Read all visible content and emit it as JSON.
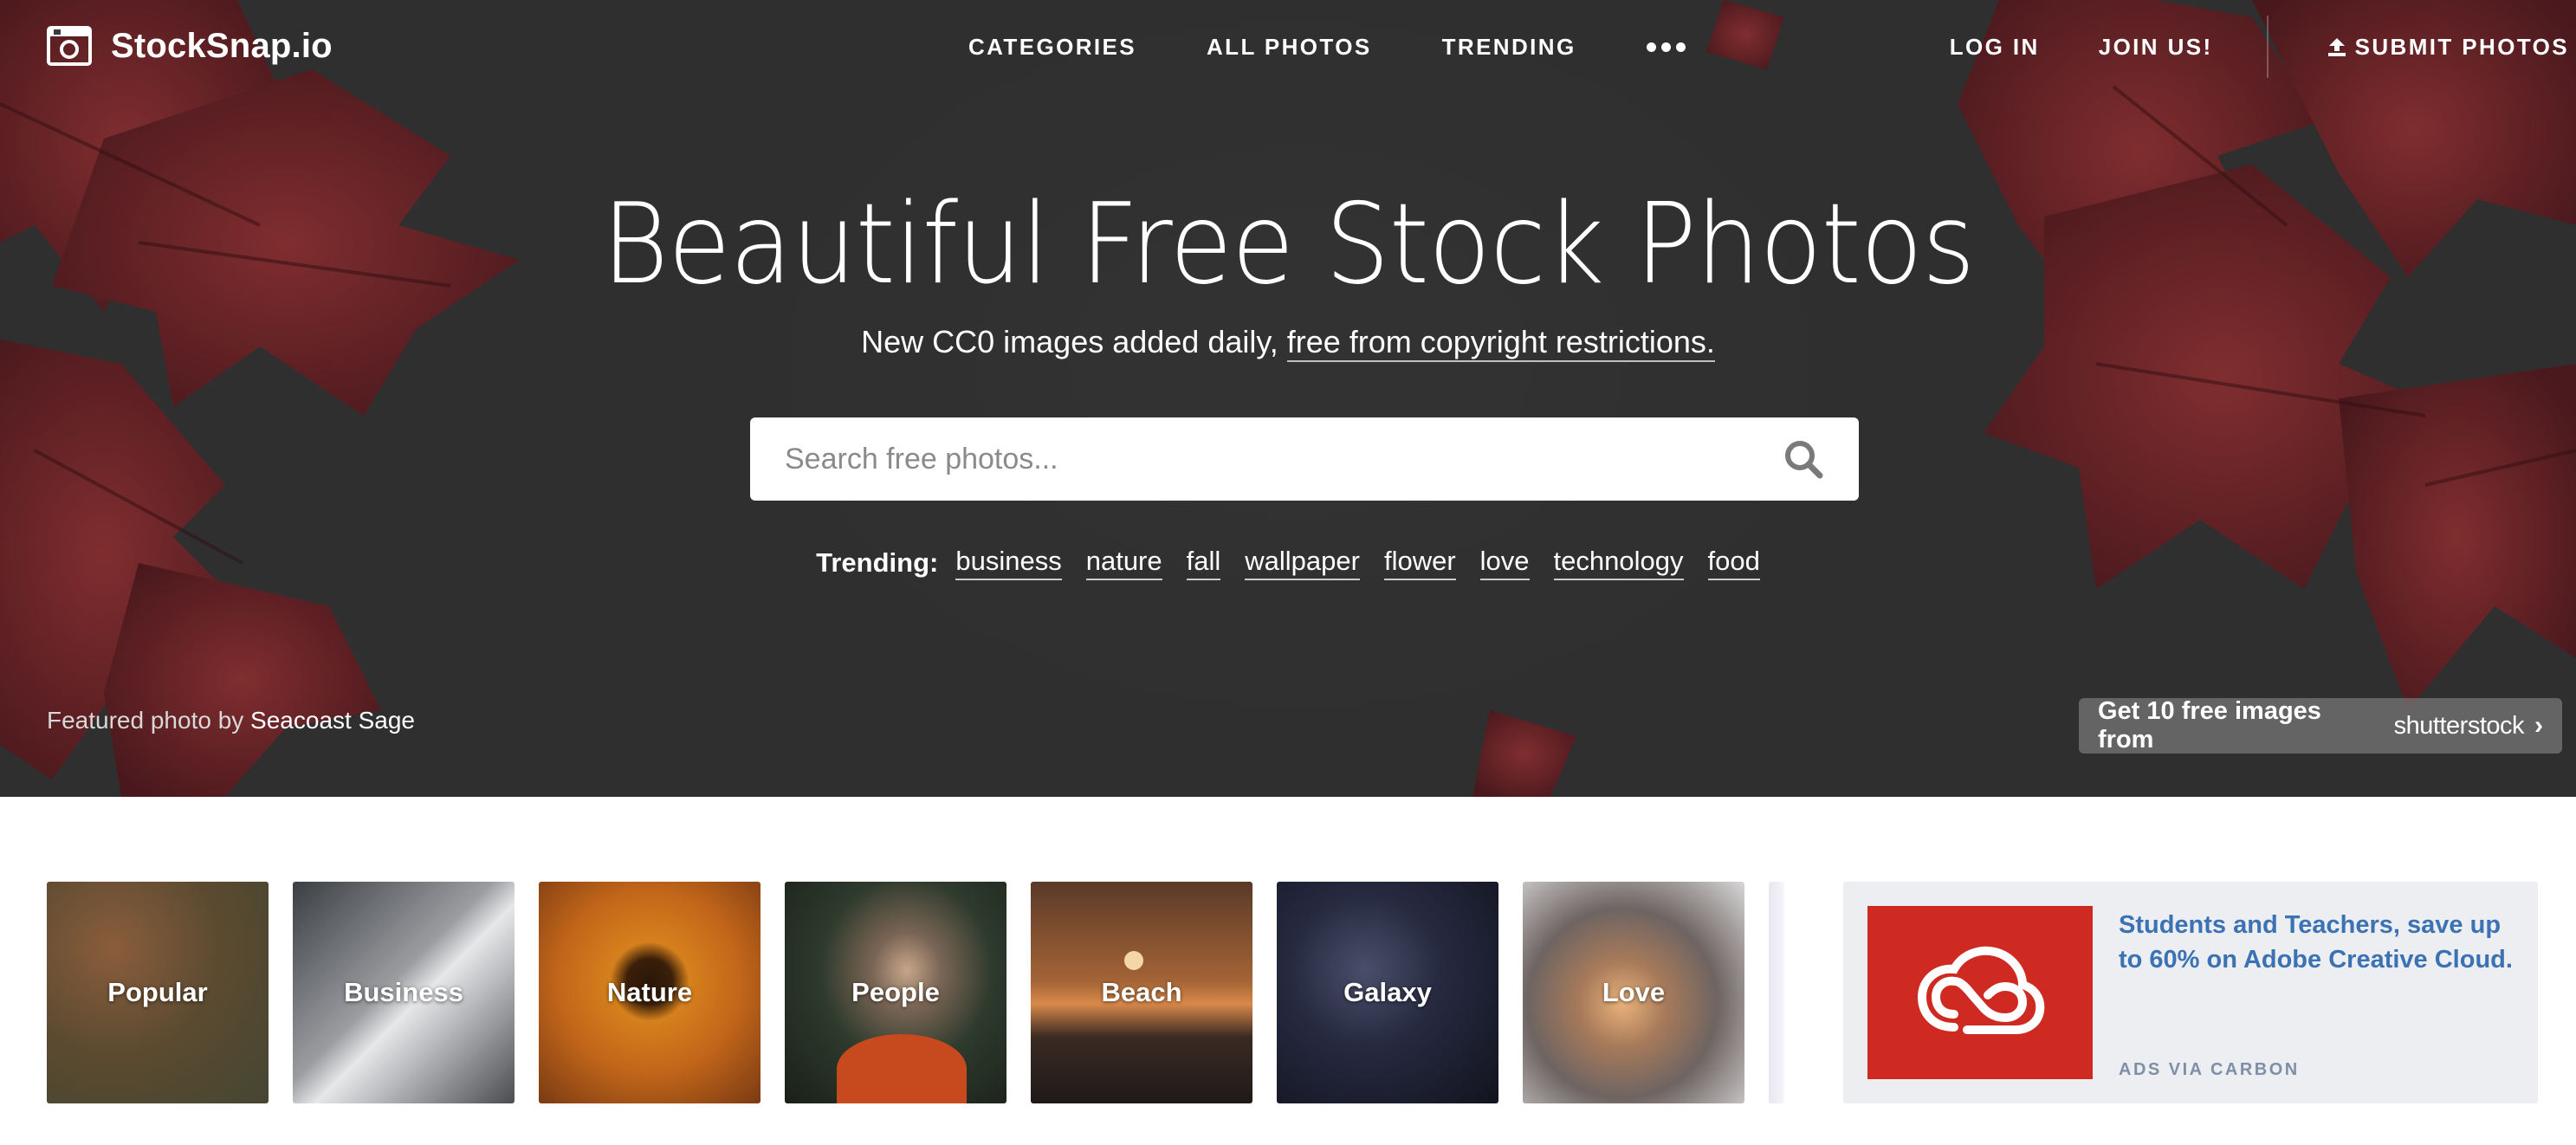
{
  "brand": {
    "name": "StockSnap.io"
  },
  "nav": {
    "center": [
      "CATEGORIES",
      "ALL PHOTOS",
      "TRENDING"
    ],
    "more_icon": "ellipsis-icon",
    "login": "LOG IN",
    "join": "JOIN US!",
    "submit": "SUBMIT PHOTOS"
  },
  "hero": {
    "title": "Beautiful Free Stock Photos",
    "subtitle_prefix": "New CC0 images added daily, ",
    "subtitle_link": "free from copyright restrictions.",
    "search_placeholder": "Search free photos...",
    "trending_label": "Trending:",
    "trending_tags": [
      "business",
      "nature",
      "fall",
      "wallpaper",
      "flower",
      "love",
      "technology",
      "food"
    ],
    "featured_prefix": "Featured photo by ",
    "featured_author": "Seacoast Sage",
    "promo_text": "Get 10 free images from",
    "promo_brand": "shutterstock"
  },
  "categories": [
    "Popular",
    "Business",
    "Nature",
    "People",
    "Beach",
    "Galaxy",
    "Love"
  ],
  "ad": {
    "text": "Students and Teachers, save up to 60% on Adobe Creative Cloud.",
    "via": "ADS VIA CARBON",
    "logo_color": "#cf2a22"
  },
  "colors": {
    "hero_bg": "#3a3a3a",
    "leaf": "#8a2a2e",
    "link_blue": "#3b72b3"
  }
}
